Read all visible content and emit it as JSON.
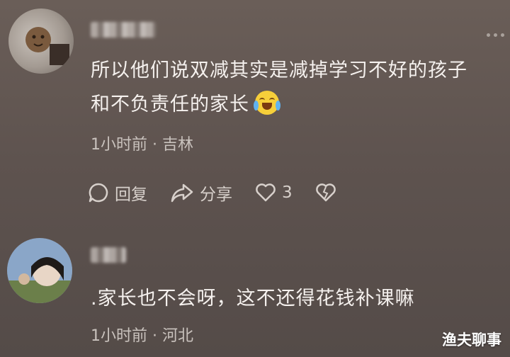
{
  "comments": [
    {
      "username": "",
      "text_line1": "所以他们说双减其实是减掉学习不好的孩子",
      "text_line2": "和不负责任的家长",
      "emoji": "crying-laughing-emoji",
      "meta": "1小时前 · 吉林",
      "actions": {
        "reply": "回复",
        "share": "分享",
        "like_count": "3"
      }
    },
    {
      "username": "",
      "text": ".家长也不会呀，这不还得花钱补课嘛",
      "meta": "1小时前 · 河北"
    }
  ],
  "watermark": "渔夫聊事",
  "icons": [
    "more-icon",
    "reply-icon",
    "share-icon",
    "like-icon",
    "dislike-icon"
  ],
  "colors": {
    "background": "#5e534f",
    "text": "#f5f1ee",
    "meta": "#c9c2bd"
  }
}
